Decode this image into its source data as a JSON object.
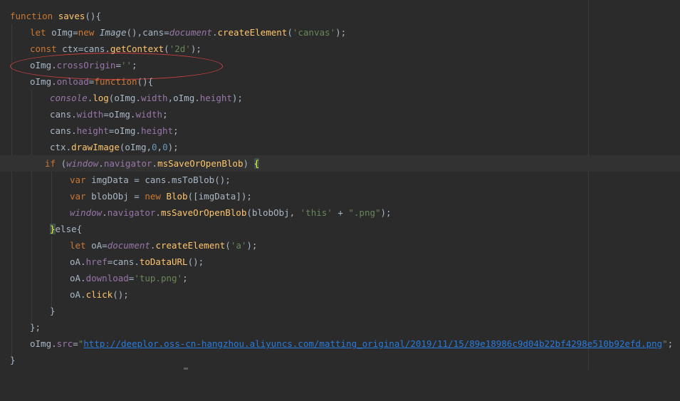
{
  "editor": {
    "lines": [
      [
        "function",
        "saves",
        "(){"
      ],
      [
        "let",
        "oImg=",
        "new",
        "Image",
        "(),cans=",
        "document",
        ".",
        "createElement",
        "(",
        "'canvas'",
        ");"
      ],
      [
        "const",
        "ctx=cans.",
        "getContext",
        "(",
        "'2d'",
        ");"
      ],
      [
        "oImg.",
        "crossOrigin",
        "=",
        "''",
        ";"
      ],
      [
        "oImg.",
        "onload",
        "=",
        "function",
        "(){"
      ],
      [
        "console",
        ".",
        "log",
        "(oImg.",
        "width",
        ",oImg.",
        "height",
        ");"
      ],
      [
        "cans.",
        "width",
        "=oImg.",
        "width",
        ";"
      ],
      [
        "cans.",
        "height",
        "=oImg.",
        "height",
        ";"
      ],
      [
        "ctx.",
        "drawImage",
        "(oImg,",
        "0",
        ",",
        "0",
        ");"
      ],
      [
        "if",
        " (",
        "window",
        ".",
        "navigator",
        ".",
        "msSaveOrOpenBlob",
        ") ",
        "{"
      ],
      [
        "var",
        " imgData = cans.msToBlob();"
      ],
      [
        "var",
        " blobObj = ",
        "new",
        "Blob",
        "([imgData]);"
      ],
      [
        "window",
        ".",
        "navigator",
        ".",
        "msSaveOrOpenBlob",
        "(blobObj, ",
        "'this'",
        " + ",
        "\".png\"",
        ");"
      ],
      [
        "}",
        "else{"
      ],
      [
        "let",
        " oA=",
        "document",
        ".",
        "createElement",
        "(",
        "'a'",
        ");"
      ],
      [
        "oA.",
        "href",
        "=cans.",
        "toDataURL",
        "();"
      ],
      [
        "oA.",
        "download",
        "=",
        "'tup.png'",
        ";"
      ],
      [
        "oA.",
        "click",
        "();"
      ],
      [
        "}"
      ],
      [
        "};"
      ],
      [
        "oImg.",
        "src",
        "=",
        "\"",
        "http://deeplor.oss-cn-hangzhou.aliyuncs.com/matting_original/2019/11/15/89e18986c9d04b22bf4298e510b92efd.png",
        "\"",
        ";"
      ],
      [
        "}"
      ]
    ]
  }
}
